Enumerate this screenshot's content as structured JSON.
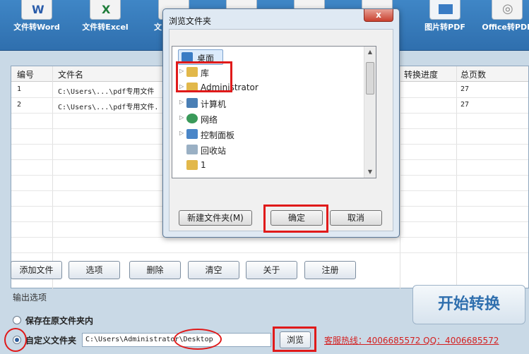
{
  "toolbar": {
    "tools": [
      {
        "label": "文件转Word"
      },
      {
        "label": "文件转Excel"
      },
      {
        "label": "文"
      },
      {
        "label": ""
      },
      {
        "label": ""
      },
      {
        "label": ""
      },
      {
        "label": "图片转PDF"
      },
      {
        "label": "Office转PDF"
      }
    ]
  },
  "table": {
    "headers": {
      "index": "编号",
      "name": "文件名",
      "progress": "转换进度",
      "pages": "总页数"
    },
    "rows": [
      {
        "index": "1",
        "name": "C:\\Users\\...\\pdf专用文件",
        "pages": "27"
      },
      {
        "index": "2",
        "name": "C:\\Users\\...\\pdf专用文件.",
        "pages": "27"
      }
    ]
  },
  "buttons": {
    "add": "添加文件",
    "options": "选项",
    "delete": "删除",
    "clear": "清空",
    "about": "关于",
    "register": "注册",
    "browse": "浏览",
    "start": "开始转换"
  },
  "output": {
    "title": "输出选项",
    "opt_original": "保存在原文件夹内",
    "opt_custom": "自定义文件夹",
    "path": "C:\\Users\\Administrator\\Desktop"
  },
  "hotline": "客服热线：4006685572 QQ：4006685572",
  "dialog": {
    "title": "浏览文件夹",
    "close": "x",
    "tree": [
      {
        "label": "桌面",
        "icon": "desktop-icon",
        "color": "#3a7cc4"
      },
      {
        "label": "库",
        "icon": "library-icon",
        "color": "#e2b84a"
      },
      {
        "label": "Administrator",
        "icon": "user-folder-icon",
        "color": "#e2b84a"
      },
      {
        "label": "计算机",
        "icon": "computer-icon",
        "color": "#4a7fb5"
      },
      {
        "label": "网络",
        "icon": "network-icon",
        "color": "#3a9a5a"
      },
      {
        "label": "控制面板",
        "icon": "control-panel-icon",
        "color": "#4a86c8"
      },
      {
        "label": "回收站",
        "icon": "recycle-bin-icon",
        "color": "#9ab0c4"
      },
      {
        "label": "1",
        "icon": "folder-icon",
        "color": "#e2b84a"
      }
    ],
    "new_folder": "新建文件夹(M)",
    "ok": "确定",
    "cancel": "取消"
  },
  "colors": {
    "toolbar": "#3f86c6",
    "annotation": "#e01a1a"
  }
}
